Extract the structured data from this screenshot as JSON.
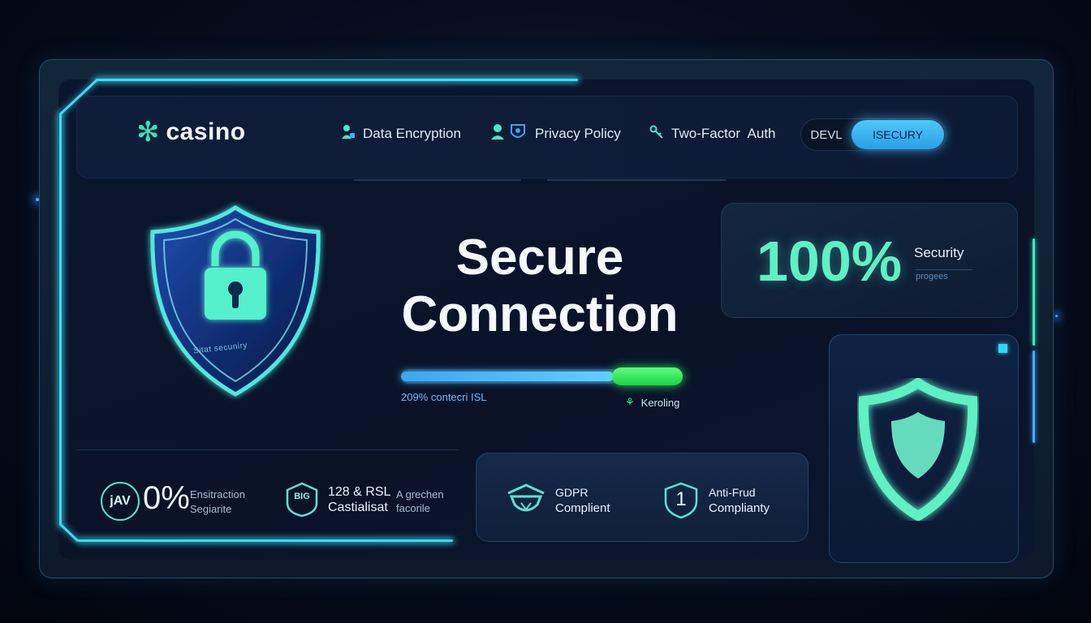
{
  "brand": {
    "name": "casino",
    "logo_icon": "flower-icon"
  },
  "nav": [
    {
      "label": "Data Encryption",
      "icon": "user-lock-icon"
    },
    {
      "label": "Privacy Policy",
      "icon": "user-shield-icon"
    },
    {
      "label": "Two-Factor  Auth",
      "icon": "key-icon"
    }
  ],
  "mode_toggle": {
    "options": [
      "DEVL",
      "ISECURY"
    ],
    "selected": "ISECURY"
  },
  "shield": {
    "caption": "Sitat secuniry"
  },
  "headline": {
    "line1": "Secure",
    "line2": "Connection"
  },
  "progress": {
    "value_fraction": 0.75,
    "caption": "209% contecri ISL",
    "status": "Keroling"
  },
  "stat": {
    "value": "100%",
    "label": "Security",
    "sub": "progees"
  },
  "badges": [
    {
      "icon_text": "jAV",
      "value": "0%",
      "line1": "Ensitraction",
      "line2": "Segiarite"
    },
    {
      "icon_text": "BIG",
      "title": "128 & RSL",
      "subtitle": "Castialisat",
      "aside1": "A grechen",
      "aside2": "facorile"
    }
  ],
  "compliance": [
    {
      "icon": "shield-ship-icon",
      "line1": "GDPR",
      "line2": "Complient"
    },
    {
      "icon_text": "1",
      "line1": "Anti-Frud",
      "line2": "Complianty"
    }
  ],
  "colors": {
    "accent": "#3fd9f0",
    "mint": "#5ff0c4",
    "toggle_on": "#4ec8f8",
    "progress_end": "#2be858"
  }
}
